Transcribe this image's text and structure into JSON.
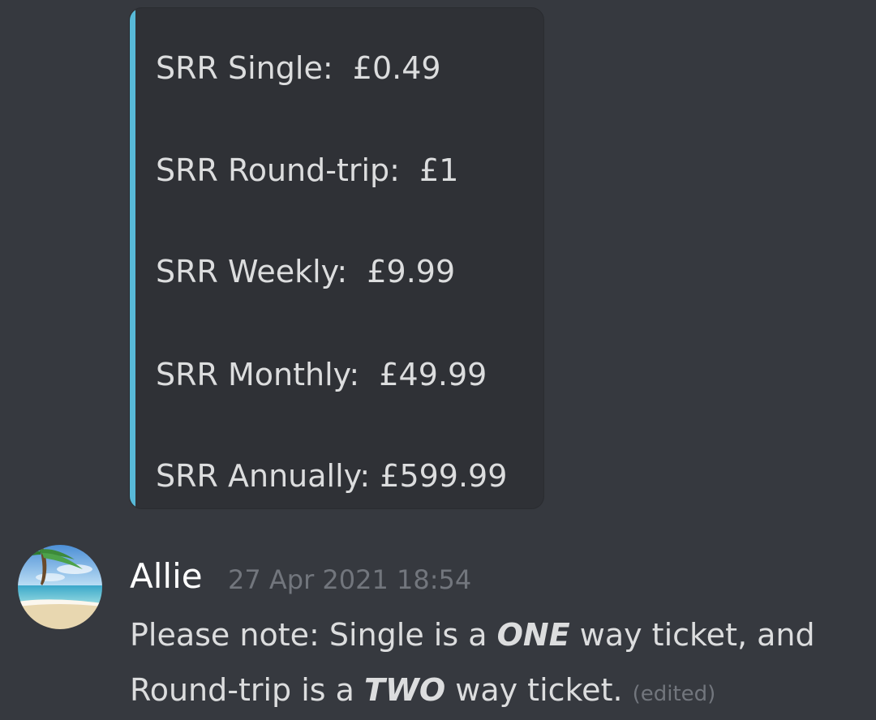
{
  "embed": {
    "accent_color": "#58b9d8",
    "lines": [
      "SRR Single:  £0.49",
      "SRR Round-trip:  £1",
      "SRR Weekly:  £9.99",
      "SRR Monthly:  £49.99",
      "SRR Annually: £599.99"
    ]
  },
  "message": {
    "avatar_icon": "beach-palm-avatar",
    "username": "Allie",
    "timestamp": "27 Apr 2021 18:54",
    "line1": {
      "before": "Please note: Single is a ",
      "emphasis": "ONE",
      "after": " way ticket, and"
    },
    "line2": {
      "before": "Round-trip is a ",
      "emphasis": "TWO",
      "after": " way ticket. "
    },
    "edited_label": "(edited)"
  }
}
